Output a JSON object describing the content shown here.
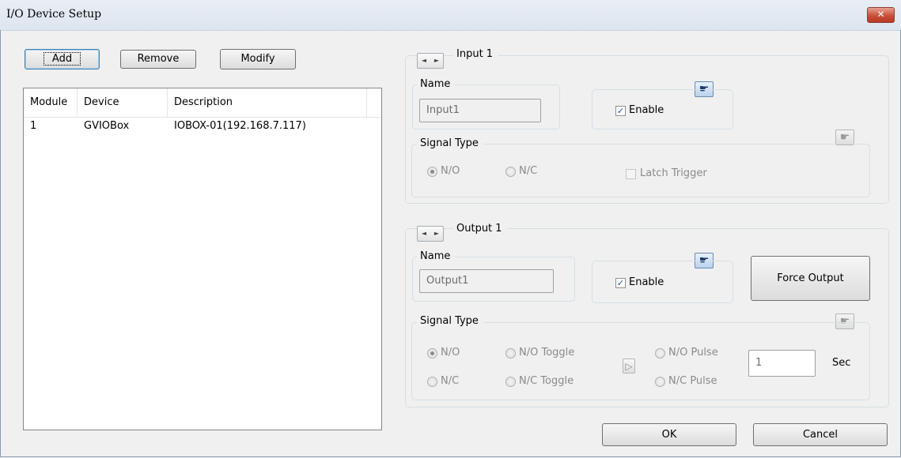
{
  "window": {
    "title": "I/O Device Setup",
    "close_glyph": "✕"
  },
  "toolbar": {
    "add": "Add",
    "remove": "Remove",
    "modify": "Modify"
  },
  "device_list": {
    "columns": [
      "Module",
      "Device",
      "Description"
    ],
    "rows": [
      {
        "module": "1",
        "device": "GVIOBox",
        "description": "IOBOX-01(192.168.7.117)"
      }
    ]
  },
  "input": {
    "header": "Input 1",
    "name_label": "Name",
    "name_value": "Input1",
    "enable_label": "Enable",
    "enable_checked": true,
    "signal_type_label": "Signal Type",
    "no_label": "N/O",
    "nc_label": "N/C",
    "selected": "N/O",
    "latch_label": "Latch Trigger",
    "latch_checked": false
  },
  "output": {
    "header": "Output 1",
    "name_label": "Name",
    "name_value": "Output1",
    "enable_label": "Enable",
    "enable_checked": true,
    "force_output": "Force Output",
    "signal_type_label": "Signal Type",
    "no_label": "N/O",
    "nc_label": "N/C",
    "no_toggle": "N/O Toggle",
    "nc_toggle": "N/C Toggle",
    "no_pulse": "N/O Pulse",
    "nc_pulse": "N/C Pulse",
    "selected": "N/O",
    "pulse_value": "1",
    "pulse_unit": "Sec"
  },
  "footer": {
    "ok": "OK",
    "cancel": "Cancel"
  },
  "icons": {
    "prev": "◄",
    "next": "►",
    "hand": "☛",
    "play": "▷",
    "check": "✓"
  },
  "colors": {
    "accent_border": "#3c7fb1",
    "close_red": "#c8503a"
  }
}
